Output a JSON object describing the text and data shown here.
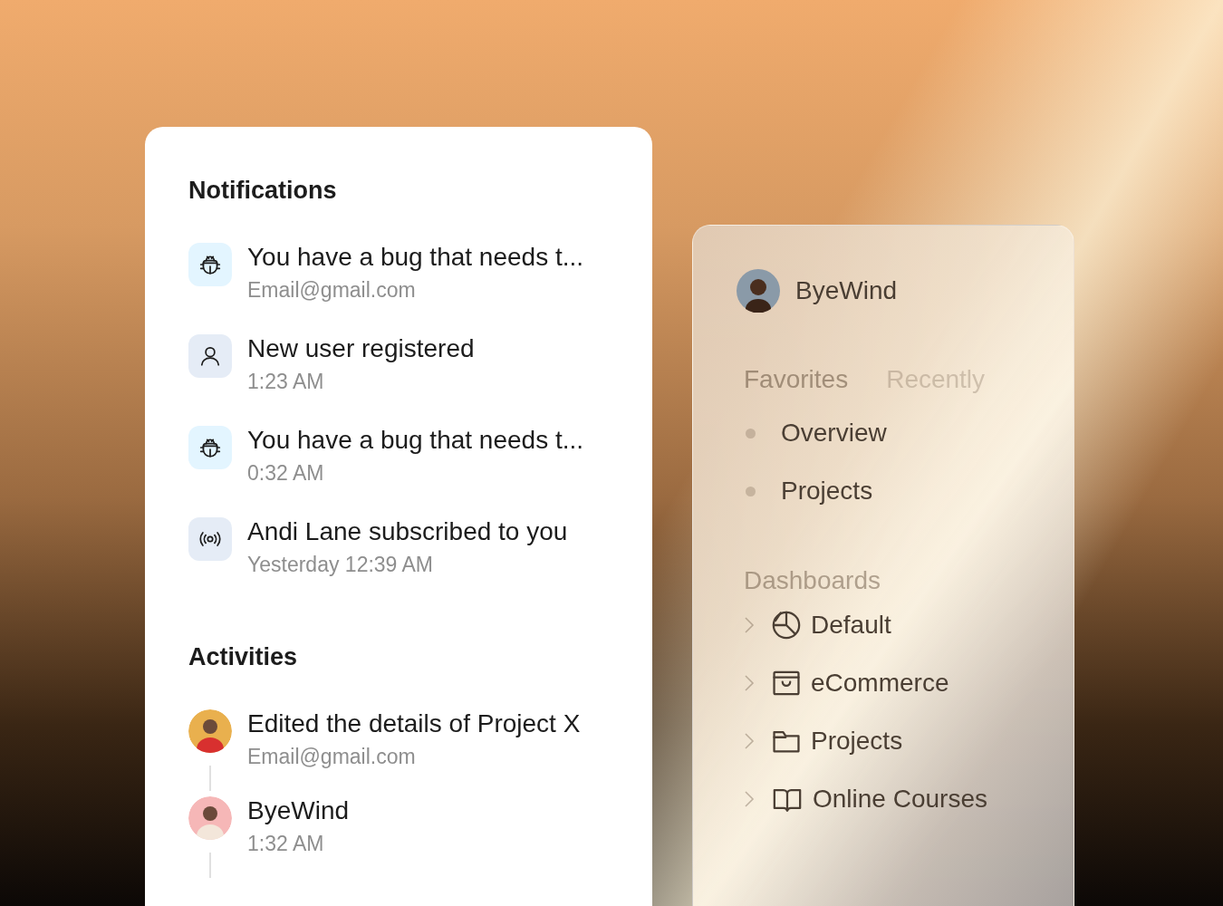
{
  "notifications": {
    "title": "Notifications",
    "items": [
      {
        "kind": "bug",
        "title": "You have a bug that needs t...",
        "subtitle": "Email@gmail.com"
      },
      {
        "kind": "user",
        "title": "New user registered",
        "subtitle": "1:23 AM"
      },
      {
        "kind": "bug",
        "title": "You have a bug that needs t...",
        "subtitle": "0:32 AM"
      },
      {
        "kind": "broadcast",
        "title": "Andi Lane subscribed to you",
        "subtitle": "Yesterday 12:39 AM"
      }
    ]
  },
  "activities": {
    "title": "Activities",
    "items": [
      {
        "title": "Edited the details of Project X",
        "subtitle": "Email@gmail.com"
      },
      {
        "title": "ByeWind",
        "subtitle": "1:32 AM"
      }
    ]
  },
  "sidebar": {
    "user": {
      "name": "ByeWind"
    },
    "tabs": [
      {
        "label": "Favorites",
        "selected": true
      },
      {
        "label": "Recently",
        "selected": false
      }
    ],
    "favorites": [
      {
        "label": "Overview"
      },
      {
        "label": "Projects"
      }
    ],
    "sections": [
      {
        "title": "Dashboards",
        "items": [
          {
            "kind": "pie",
            "label": "Default"
          },
          {
            "kind": "store",
            "label": "eCommerce"
          },
          {
            "kind": "folder",
            "label": "Projects"
          },
          {
            "kind": "book",
            "label": "Online Courses"
          }
        ]
      }
    ]
  }
}
